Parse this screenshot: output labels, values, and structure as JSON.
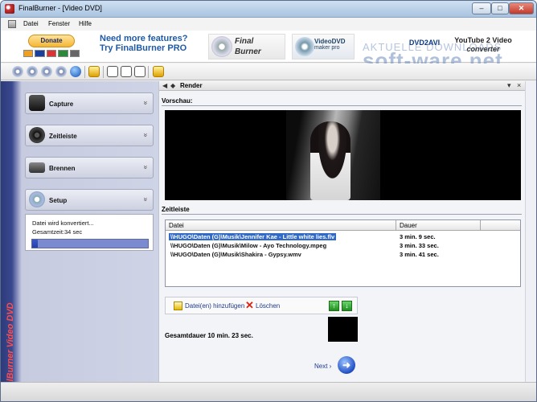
{
  "window": {
    "title": "FinalBurner - [Video DVD]",
    "min": "‒",
    "max": "□",
    "close": "✕"
  },
  "menu": [
    "Datei",
    "Fenster",
    "Hilfe"
  ],
  "banner": {
    "donate": "Donate",
    "ad_line1": "Need more features?",
    "ad_line2": "Try FinalBurner PRO",
    "fb_line1": "Final",
    "fb_line2": "Burner",
    "vdvd_line1": "VideoDVD",
    "vdvd_line2": "maker pro",
    "dvd2avi": "DVD2AVI",
    "yt_line1": "YouTube 2 Video",
    "yt_line2": "converter",
    "watermark": "soft-ware.net",
    "watermark_sub": "AKTUELLE DOWNLOADS"
  },
  "sidebar": {
    "vertical_title": "FinalBurner Video DVD",
    "items": [
      {
        "label": "Capture",
        "icon": "camcorder-icon"
      },
      {
        "label": "Zeitleiste",
        "icon": "film-reel-icon"
      },
      {
        "label": "Brennen",
        "icon": "dvd-drive-icon"
      },
      {
        "label": "Setup",
        "icon": "gear-icon"
      }
    ],
    "chevron": "»",
    "status_line1": "Datei wird konvertiert...",
    "status_line2": "Gesamtzeit:34 sec",
    "progress_fraction": 0.05
  },
  "panel": {
    "title": "Render",
    "preview_label": "Vorschau:",
    "timeline_label": "Zeitleiste",
    "columns": [
      "Datei",
      "Dauer"
    ],
    "rows": [
      {
        "file": "\\\\HUGO\\Daten (G)\\Musik\\Jennifer Kae - Little white lies.flv",
        "duration": "3 min. 9 sec.",
        "selected": true
      },
      {
        "file": "\\\\HUGO\\Daten (G)\\Musik\\Milow - Ayo Technology.mpeg",
        "duration": "3 min. 33 sec.",
        "selected": false
      },
      {
        "file": "\\\\HUGO\\Daten (G)\\Musik\\Shakira - Gypsy.wmv",
        "duration": "3 min. 41 sec.",
        "selected": false
      }
    ],
    "add_files": "Datei(en) hinzufügen",
    "delete": "Löschen",
    "up": "↑",
    "down": "↓",
    "total": "Gesamtdauer 10 min. 23 sec.",
    "next": "Next ›",
    "next_icon": "➜"
  }
}
